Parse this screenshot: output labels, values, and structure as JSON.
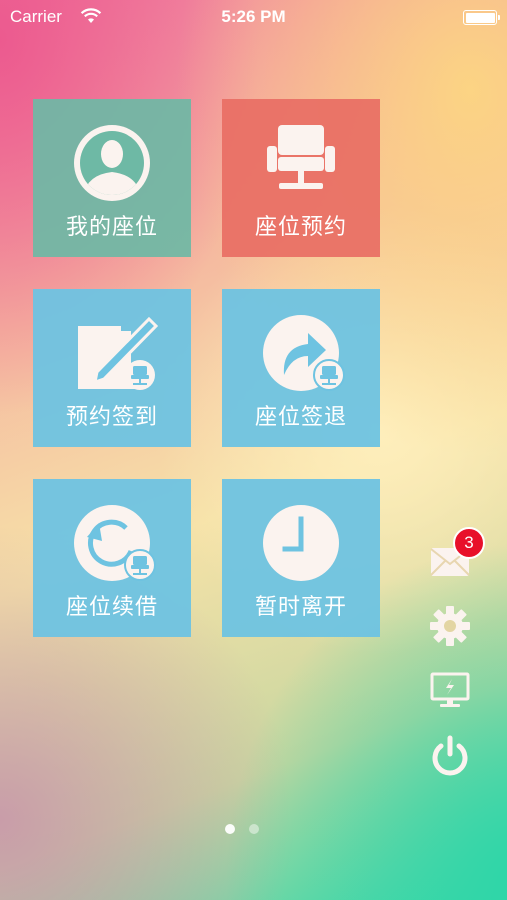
{
  "status_bar": {
    "carrier": "Carrier",
    "time": "5:26 PM"
  },
  "tiles": [
    {
      "label": "我的座位",
      "icon": "user-avatar-icon",
      "color": "#6eb9a5"
    },
    {
      "label": "座位预约",
      "icon": "chair-icon",
      "color": "#e86e64"
    },
    {
      "label": "预约签到",
      "icon": "sign-in-edit-icon",
      "color": "#6ec3e1"
    },
    {
      "label": "座位签退",
      "icon": "sign-out-arrow-icon",
      "color": "#6ec3e1"
    },
    {
      "label": "座位续借",
      "icon": "renew-refresh-icon",
      "color": "#6ec3e1"
    },
    {
      "label": "暂时离开",
      "icon": "clock-icon",
      "color": "#6ec3e1"
    }
  ],
  "side_actions": {
    "messages": {
      "icon": "mail-icon",
      "badge": "3"
    },
    "settings": {
      "icon": "gear-icon"
    },
    "screen": {
      "icon": "monitor-icon"
    },
    "power": {
      "icon": "power-icon"
    }
  },
  "pager": {
    "current": 1,
    "total": 2
  },
  "colors": {
    "badge": "#e8102a",
    "icon_fill": "#fbf3ef"
  }
}
